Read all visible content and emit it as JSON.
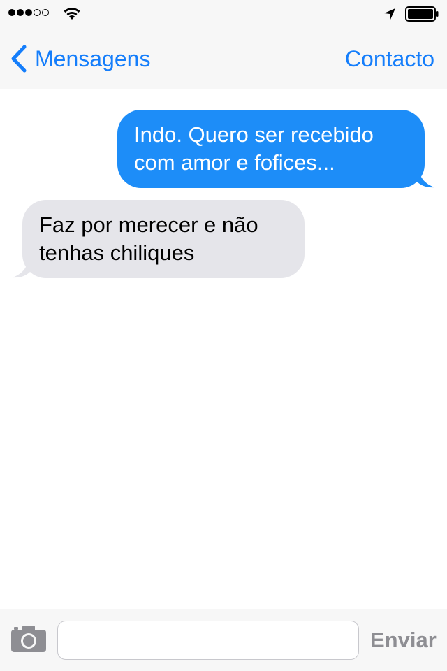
{
  "status_bar": {
    "signal_icon": "signal-dots-icon",
    "wifi_icon": "wifi-icon",
    "location_icon": "location-arrow-icon",
    "battery_icon": "battery-icon",
    "signal_bars_filled": 3,
    "signal_bars_total": 5
  },
  "nav": {
    "back_label": "Mensagens",
    "back_icon": "chevron-left-icon",
    "contact_label": "Contacto",
    "accent_color": "#157efb"
  },
  "messages": [
    {
      "direction": "outgoing",
      "text": "Indo. Quero ser recebido com amor e fofices..."
    },
    {
      "direction": "incoming",
      "text": "Faz por merecer e não tenhas chiliques"
    }
  ],
  "colors": {
    "outgoing_bubble": "#1d8df8",
    "incoming_bubble": "#e5e5ea"
  },
  "input_bar": {
    "camera_icon": "camera-icon",
    "message_value": "",
    "send_label": "Enviar"
  }
}
